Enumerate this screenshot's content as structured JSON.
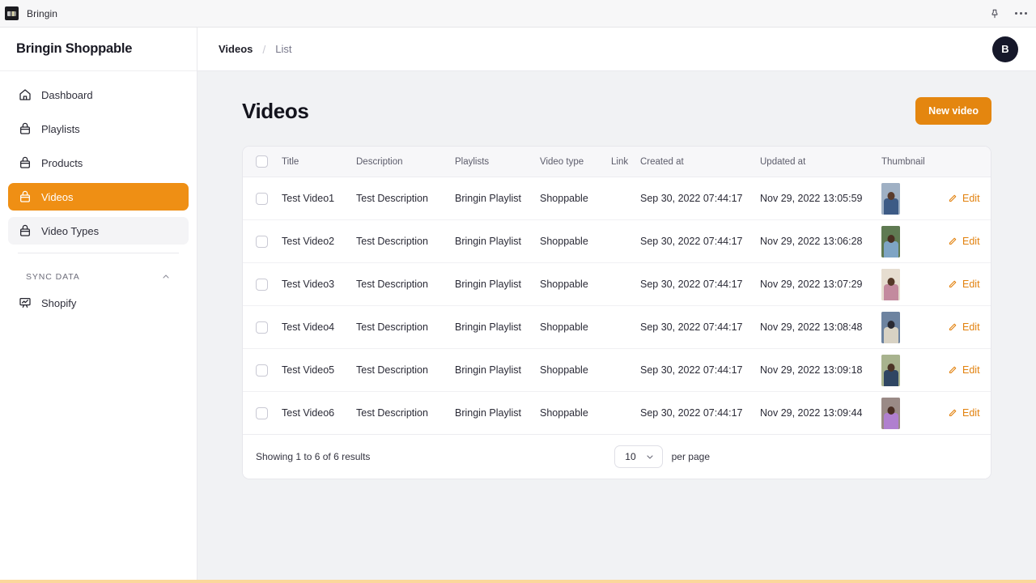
{
  "titlebar": {
    "app_name": "Bringin",
    "logo_icon": "bringin-logo-icon",
    "pin_icon": "pin-icon",
    "more_icon": "ellipsis-icon"
  },
  "sidebar": {
    "brand": "Bringin Shoppable",
    "items": [
      {
        "label": "Dashboard",
        "icon": "home-icon",
        "state": "default"
      },
      {
        "label": "Playlists",
        "icon": "bag-icon",
        "state": "default"
      },
      {
        "label": "Products",
        "icon": "bag-icon",
        "state": "default"
      },
      {
        "label": "Videos",
        "icon": "bag-icon",
        "state": "active"
      },
      {
        "label": "Video Types",
        "icon": "bag-icon",
        "state": "soft"
      }
    ],
    "group": {
      "label": "SYNC DATA",
      "caret_icon": "chevron-up-icon",
      "items": [
        {
          "label": "Shopify",
          "icon": "presentation-chart-icon"
        }
      ]
    }
  },
  "topbar": {
    "breadcrumb_current": "Videos",
    "breadcrumb_separator": "/",
    "breadcrumb_sub": "List",
    "avatar_initial": "B"
  },
  "page": {
    "title": "Videos",
    "new_button": "New video"
  },
  "table": {
    "select_all_icon": "checkbox-icon",
    "headers": {
      "title": "Title",
      "description": "Description",
      "playlists": "Playlists",
      "video_type": "Video type",
      "link": "Link",
      "created_at": "Created at",
      "updated_at": "Updated at",
      "thumbnail": "Thumbnail"
    },
    "edit_label": "Edit",
    "edit_icon": "pencil-icon",
    "rows": [
      {
        "title": "Test Video1",
        "description": "Test Description",
        "playlists": "Bringin Playlist",
        "video_type": "Shoppable",
        "link": "",
        "created_at": "Sep 30, 2022 07:44:17",
        "updated_at": "Nov 29, 2022 13:05:59"
      },
      {
        "title": "Test Video2",
        "description": "Test Description",
        "playlists": "Bringin Playlist",
        "video_type": "Shoppable",
        "link": "",
        "created_at": "Sep 30, 2022 07:44:17",
        "updated_at": "Nov 29, 2022 13:06:28"
      },
      {
        "title": "Test Video3",
        "description": "Test Description",
        "playlists": "Bringin Playlist",
        "video_type": "Shoppable",
        "link": "",
        "created_at": "Sep 30, 2022 07:44:17",
        "updated_at": "Nov 29, 2022 13:07:29"
      },
      {
        "title": "Test Video4",
        "description": "Test Description",
        "playlists": "Bringin Playlist",
        "video_type": "Shoppable",
        "link": "",
        "created_at": "Sep 30, 2022 07:44:17",
        "updated_at": "Nov 29, 2022 13:08:48"
      },
      {
        "title": "Test Video5",
        "description": "Test Description",
        "playlists": "Bringin Playlist",
        "video_type": "Shoppable",
        "link": "",
        "created_at": "Sep 30, 2022 07:44:17",
        "updated_at": "Nov 29, 2022 13:09:18"
      },
      {
        "title": "Test Video6",
        "description": "Test Description",
        "playlists": "Bringin Playlist",
        "video_type": "Shoppable",
        "link": "",
        "created_at": "Sep 30, 2022 07:44:17",
        "updated_at": "Nov 29, 2022 13:09:44"
      }
    ],
    "footer": {
      "showing": "Showing 1 to 6 of 6 results",
      "per_page_value": "10",
      "per_page_label": "per page",
      "caret_icon": "chevron-down-icon"
    }
  },
  "colors": {
    "accent_orange": "#ef8f14",
    "button_orange": "#e4860f",
    "edit_orange": "#e2810d",
    "avatar_bg": "#16182a",
    "content_bg": "#f1f2f4",
    "bottom_strip": "#fbd79b"
  }
}
